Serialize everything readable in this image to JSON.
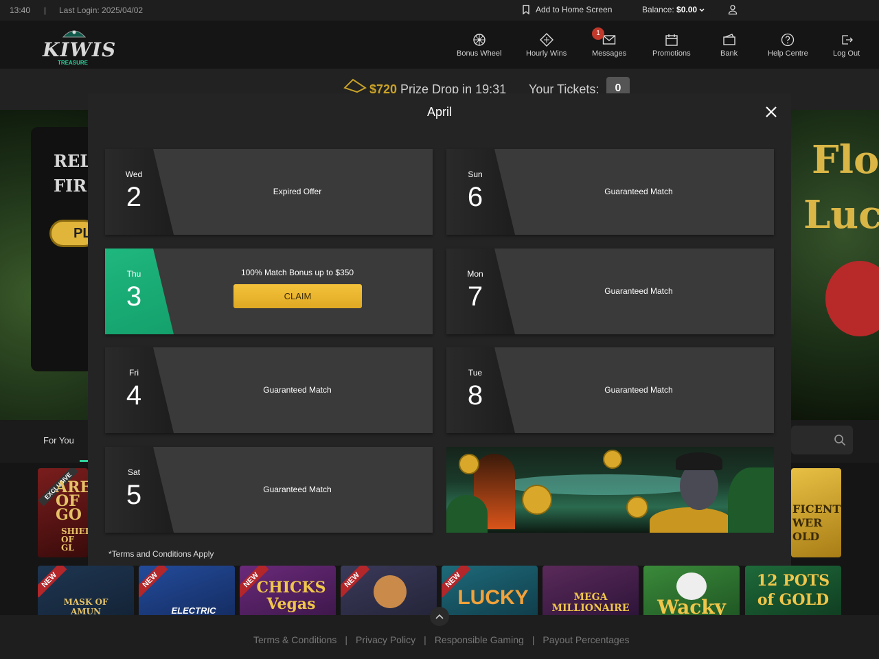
{
  "topbar": {
    "time": "13:40",
    "separator": "|",
    "last_login": "Last Login: 2025/04/02",
    "add_home": "Add to Home Screen",
    "balance_label": "Balance:",
    "balance_value": "$0.00"
  },
  "header": {
    "logo_word": "KIWIS",
    "logo_sub": "TREASURE",
    "nav": [
      {
        "label": "Bonus Wheel",
        "icon": "wheel-icon"
      },
      {
        "label": "Hourly Wins",
        "icon": "diamond-ticket-icon"
      },
      {
        "label": "Messages",
        "icon": "envelope-icon",
        "badge": "1"
      },
      {
        "label": "Promotions",
        "icon": "calendar-icon"
      },
      {
        "label": "Bank",
        "icon": "wallet-icon"
      },
      {
        "label": "Help Centre",
        "icon": "help-icon"
      },
      {
        "label": "Log Out",
        "icon": "logout-icon"
      }
    ]
  },
  "prize_bar": {
    "amount": "$720",
    "text": " Prize Drop in 19:31",
    "tickets_label": "Your Tickets:",
    "tickets_value": "0"
  },
  "hero": {
    "left_line1": "REL",
    "left_line2": "FIR",
    "left_button": "PL",
    "right_line1": "Flo",
    "right_line2": "Luck"
  },
  "categories": {
    "for_you": "For You"
  },
  "modal": {
    "title": "April",
    "offers": [
      {
        "dow": "Wed",
        "day": "2",
        "label": "Expired Offer"
      },
      {
        "dow": "Thu",
        "day": "3",
        "label": "100% Match Bonus up to $350",
        "button": "CLAIM"
      },
      {
        "dow": "Fri",
        "day": "4",
        "label": "Guaranteed Match"
      },
      {
        "dow": "Sat",
        "day": "5",
        "label": "Guaranteed Match"
      },
      {
        "dow": "Sun",
        "day": "6",
        "label": "Guaranteed Match"
      },
      {
        "dow": "Mon",
        "day": "7",
        "label": "Guaranteed Match"
      },
      {
        "dow": "Tue",
        "day": "8",
        "label": "Guaranteed Match"
      }
    ],
    "terms": "*Terms and Conditions Apply"
  },
  "games_row2": [
    {
      "badge": "NEW",
      "title": "MASK OF AMUN"
    },
    {
      "badge": "NEW",
      "title": "ELECTRIC"
    },
    {
      "badge": "NEW",
      "title": "CHICKS Vegas"
    },
    {
      "badge": "NEW",
      "title": ""
    },
    {
      "badge": "NEW",
      "title": "LUCKY"
    },
    {
      "badge": "",
      "title": "MEGA MILLIONAIRE"
    },
    {
      "badge": "",
      "title": "Wacky"
    },
    {
      "badge": "",
      "title": "12 POTS of GOLD"
    }
  ],
  "games_row1": [
    {
      "badge": "EXCLUSIVE",
      "title": "AREA OF GO",
      "sub": "SHIELD OF GL"
    },
    {
      "title": "FICENT WER OLD"
    }
  ],
  "footer": {
    "links": [
      "Terms & Conditions",
      "Privacy Policy",
      "Responsible Gaming",
      "Payout Percentages"
    ],
    "separator": "|"
  },
  "colors": {
    "accent_green": "#1fb77e",
    "claim_gold": "#f4c33b",
    "badge_red": "#c0392b"
  }
}
